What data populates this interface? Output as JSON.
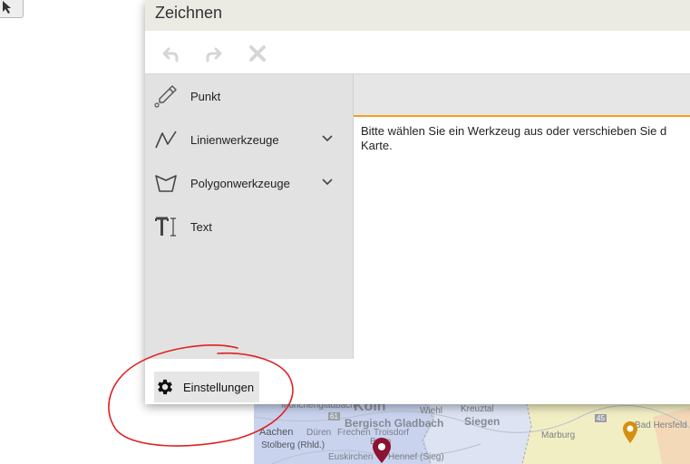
{
  "corner_tool": {
    "icon": "cursor-arrow-icon"
  },
  "dialog": {
    "title": "Zeichnen",
    "toolbar": {
      "undo_icon": "undo-icon",
      "redo_icon": "redo-icon",
      "delete_icon": "close-icon"
    },
    "tools": [
      {
        "label": "Punkt",
        "icon": "pencil-icon",
        "expandable": false
      },
      {
        "label": "Linienwerkzeuge",
        "icon": "polyline-icon",
        "expandable": true
      },
      {
        "label": "Polygonwerkzeuge",
        "icon": "polygon-icon",
        "expandable": true
      },
      {
        "label": "Text",
        "icon": "text-tool-icon",
        "expandable": false
      }
    ],
    "message": "Bitte wählen Sie ein Werkzeug aus oder verschieben Sie d\nKarte.",
    "settings_label": "Einstellungen",
    "accent_color": "#f0a020"
  },
  "map": {
    "labels": [
      "Köln",
      "Bergisch Gladbach",
      "Wiehl",
      "Kreuztal",
      "Siegen",
      "Marburg",
      "Bad Hersfeld",
      "Aachen",
      "Düren",
      "Frechen",
      "Troisdorf",
      "Stolberg (Rhld.)",
      "Euskirchen",
      "Hennef (Sieg)",
      "Mönchengladbach",
      "Bonn",
      "45",
      "61"
    ],
    "markers": [
      {
        "icon": "map-marker-icon",
        "color": "#8b1430"
      },
      {
        "icon": "map-marker-icon",
        "color": "#d4900e"
      }
    ]
  },
  "annotation": {
    "color": "#e02020"
  }
}
